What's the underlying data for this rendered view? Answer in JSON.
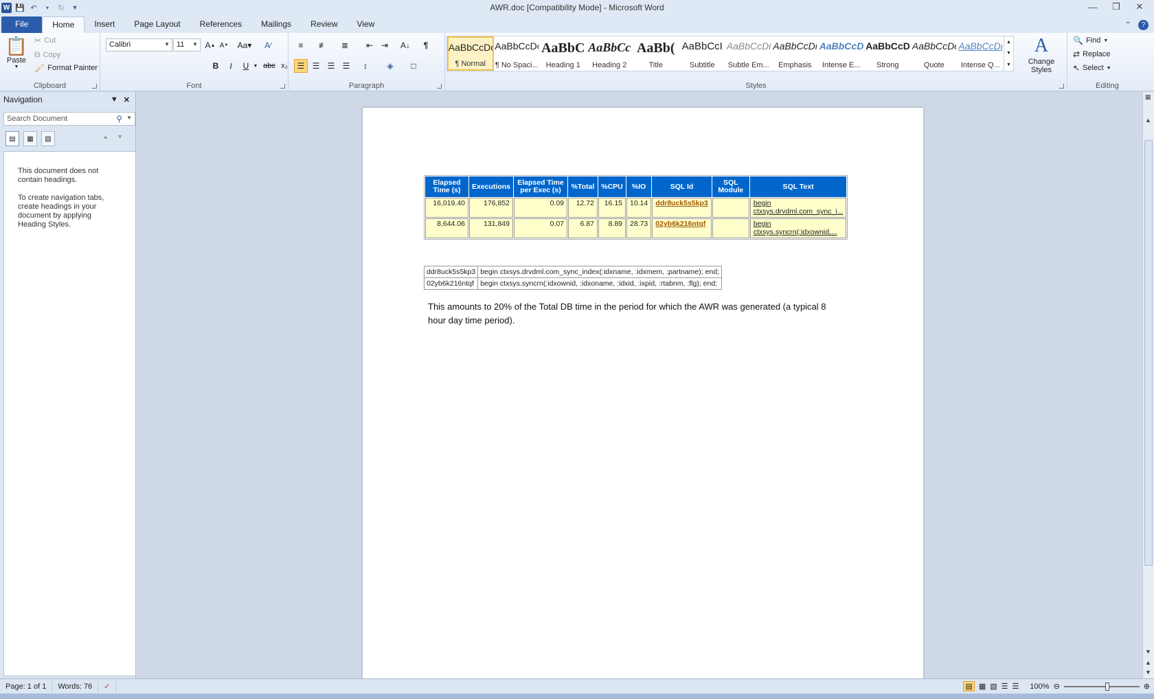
{
  "window": {
    "title": "AWR.doc [Compatibility Mode]  -  Microsoft Word"
  },
  "tabs": [
    "File",
    "Home",
    "Insert",
    "Page Layout",
    "References",
    "Mailings",
    "Review",
    "View"
  ],
  "clipboard": {
    "paste": "Paste",
    "cut": "Cut",
    "copy": "Copy",
    "format_painter": "Format Painter",
    "label": "Clipboard"
  },
  "font": {
    "name": "Calibri",
    "size": "11",
    "label": "Font"
  },
  "paragraph": {
    "label": "Paragraph"
  },
  "styles": {
    "label": "Styles",
    "items": [
      {
        "preview": "AaBbCcDc",
        "name": "¶ Normal"
      },
      {
        "preview": "AaBbCcDc",
        "name": "¶ No Spaci..."
      },
      {
        "preview": "AaBbC",
        "name": "Heading 1"
      },
      {
        "preview": "AaBbCc",
        "name": "Heading 2"
      },
      {
        "preview": "AaBb(",
        "name": "Title"
      },
      {
        "preview": "AaBbCcI",
        "name": "Subtitle"
      },
      {
        "preview": "AaBbCcDi",
        "name": "Subtle Em..."
      },
      {
        "preview": "AaBbCcDi",
        "name": "Emphasis"
      },
      {
        "preview": "AaBbCcDi",
        "name": "Intense E..."
      },
      {
        "preview": "AaBbCcDc",
        "name": "Strong"
      },
      {
        "preview": "AaBbCcDc",
        "name": "Quote"
      },
      {
        "preview": "AaBbCcDi",
        "name": "Intense Q..."
      }
    ],
    "change_styles": "Change Styles"
  },
  "editing": {
    "label": "Editing",
    "find": "Find",
    "replace": "Replace",
    "select": "Select"
  },
  "navigation": {
    "title": "Navigation",
    "search_placeholder": "Search Document",
    "message1": "This document does not contain headings.",
    "message2": "To create navigation tabs, create headings in your document by applying Heading Styles."
  },
  "awr_table": {
    "headers": [
      "Elapsed Time (s)",
      "Executions",
      "Elapsed Time per Exec (s)",
      "%Total",
      "%CPU",
      "%IO",
      "SQL Id",
      "SQL Module",
      "SQL Text"
    ],
    "rows": [
      {
        "elapsed": "16,019.40",
        "executions": "176,852",
        "per_exec": "0.09",
        "total": "12.72",
        "cpu": "16.15",
        "io": "10.14",
        "sql_id": "ddr8uck5s5kp3",
        "module": "",
        "text_line1": "begin",
        "text_line2": "ctxsys.drvdml.com_sync_i..."
      },
      {
        "elapsed": "8,644.06",
        "executions": "131,849",
        "per_exec": "0.07",
        "total": "6.87",
        "cpu": "8.89",
        "io": "28.73",
        "sql_id": "02yb6k216ntqf",
        "module": "",
        "text_line1": "begin",
        "text_line2": "ctxsys.syncrn(:idxownid,..."
      }
    ]
  },
  "sql_map": [
    {
      "id": "ddr8uck5s5kp3",
      "text": "begin ctxsys.drvdml.com_sync_index(:idxname, :idxmem, :partname); end;"
    },
    {
      "id": "02yb6k216ntqf",
      "text": "begin ctxsys.syncrn(:idxownid, :idxoname, :idxid, :ixpid, :rtabnm, :flg); end;"
    }
  ],
  "body_text": "This amounts to 20% of the Total DB time in the period for which the AWR was generated (a typical 8 hour day time period).",
  "status": {
    "page": "Page: 1 of 1",
    "words": "Words: 76",
    "zoom": "100%"
  }
}
